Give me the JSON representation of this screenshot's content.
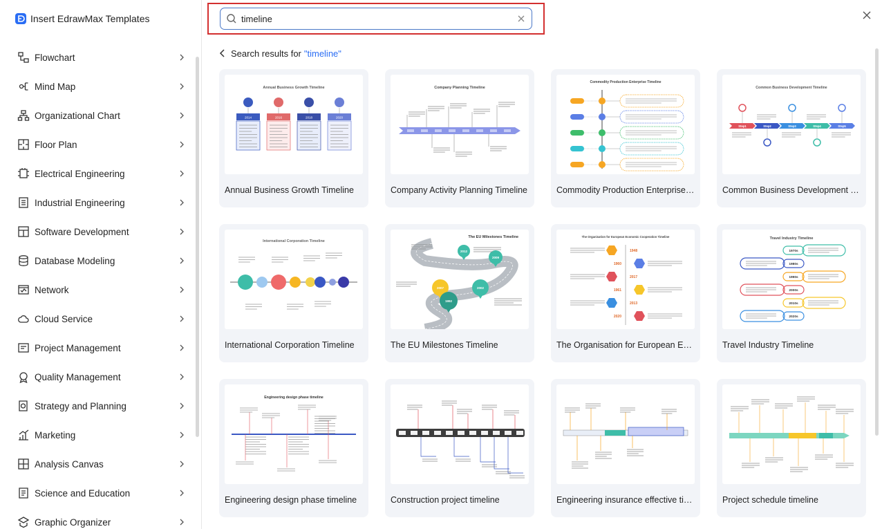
{
  "app": {
    "title": "Insert EdrawMax Templates"
  },
  "sidebar": {
    "items": [
      {
        "label": "Flowchart",
        "icon": "flowchart-icon"
      },
      {
        "label": "Mind Map",
        "icon": "mind-map-icon"
      },
      {
        "label": "Organizational Chart",
        "icon": "org-chart-icon"
      },
      {
        "label": "Floor Plan",
        "icon": "floor-plan-icon"
      },
      {
        "label": "Electrical Engineering",
        "icon": "electrical-icon"
      },
      {
        "label": "Industrial Engineering",
        "icon": "industrial-icon"
      },
      {
        "label": "Software Development",
        "icon": "software-icon"
      },
      {
        "label": "Database Modeling",
        "icon": "database-icon"
      },
      {
        "label": "Network",
        "icon": "network-icon"
      },
      {
        "label": "Cloud Service",
        "icon": "cloud-icon"
      },
      {
        "label": "Project Management",
        "icon": "project-icon"
      },
      {
        "label": "Quality Management",
        "icon": "quality-icon"
      },
      {
        "label": "Strategy and Planning",
        "icon": "strategy-icon"
      },
      {
        "label": "Marketing",
        "icon": "marketing-icon"
      },
      {
        "label": "Analysis Canvas",
        "icon": "analysis-icon"
      },
      {
        "label": "Science and Education",
        "icon": "science-icon"
      },
      {
        "label": "Graphic Organizer",
        "icon": "graphic-organizer-icon"
      }
    ]
  },
  "search": {
    "value": "timeline",
    "placeholder": ""
  },
  "results": {
    "prefix": "Search results for",
    "query": "\"timeline\""
  },
  "templates": [
    {
      "title": "Annual Business Growth Timeline",
      "thumb_heading": "Annual Business Growth Timeline",
      "years": [
        "2014",
        "2016",
        "2018",
        "2020"
      ]
    },
    {
      "title": "Company Activity Planning Timeline",
      "thumb_heading": "Company Planning Timeline"
    },
    {
      "title": "Commodity Production Enterprise Timeline",
      "thumb_heading": "Commodity Production Enterprise Timeline"
    },
    {
      "title": "Common Business Development Timeline",
      "thumb_heading": "Common Business Development Timeline",
      "steps": [
        "Step1",
        "Step2",
        "Step3",
        "Step4",
        "Step5"
      ]
    },
    {
      "title": "International Corporation Timeline",
      "thumb_heading": "International Corporation Timeline"
    },
    {
      "title": "The EU Milestones Timeline",
      "thumb_heading": "The EU Milestones Timeline",
      "years": [
        "2007",
        "2012",
        "2009",
        "1992",
        "2002"
      ]
    },
    {
      "title": "The Organisation for European Economic Co-operation Timeline",
      "thumb_heading": "The Organisation for European Economic Cooperation Timeline",
      "years": [
        "1948",
        "1960",
        "2017",
        "1961",
        "2013",
        "2020"
      ]
    },
    {
      "title": "Travel Industry Timeline",
      "thumb_heading": "Travel Industry Timeline",
      "years": [
        "1970s",
        "1980s",
        "1990s",
        "2000s",
        "2010s",
        "2020s"
      ]
    },
    {
      "title": "Engineering design phase timeline",
      "thumb_heading": "Engineering design phase timeline"
    },
    {
      "title": "Construction project timeline",
      "thumb_heading": ""
    },
    {
      "title": "Engineering insurance effective timeline",
      "thumb_heading": ""
    },
    {
      "title": "Project schedule timeline",
      "thumb_heading": ""
    }
  ],
  "colors": {
    "accent": "#2a6df4",
    "highlight_border": "#d32f2f"
  }
}
